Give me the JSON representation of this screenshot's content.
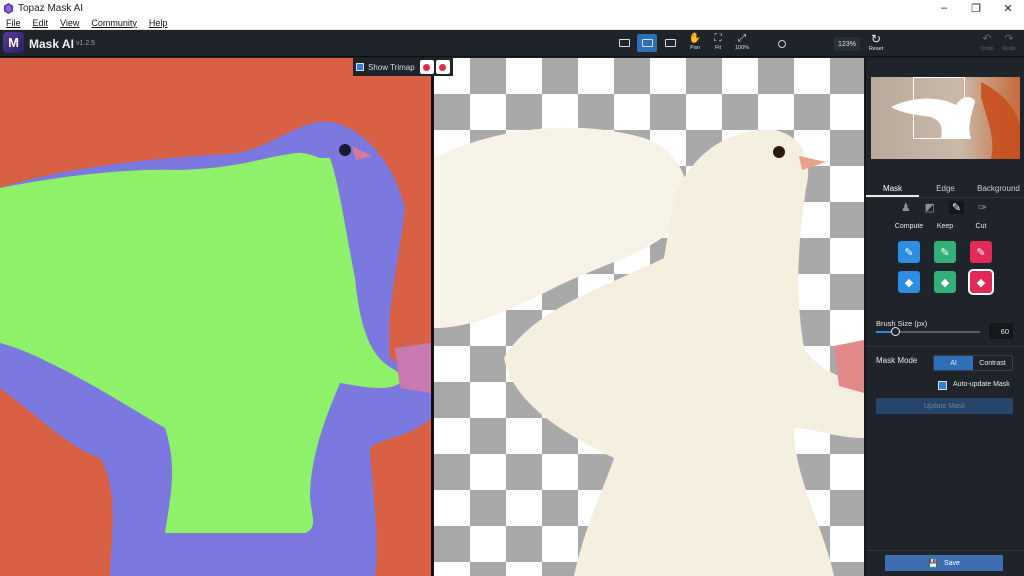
{
  "window": {
    "title": "Topaz Mask AI",
    "minimize": "–",
    "maximize": "❐",
    "close": "✕"
  },
  "menu": {
    "items": [
      "File",
      "Edit",
      "View",
      "Community",
      "Help"
    ]
  },
  "header": {
    "logo_letter": "M",
    "app_name": "Mask AI",
    "version": "v1.2.5"
  },
  "toolbar": {
    "tools": [
      {
        "icon": "hand-icon",
        "glyph": "✋",
        "label": "Pan"
      },
      {
        "icon": "fit-icon",
        "glyph": "⛶",
        "label": "Fit"
      },
      {
        "icon": "zoom-100-icon",
        "glyph": "⤢",
        "label": "100%"
      }
    ],
    "zoom_value": "123%",
    "reset_label": "Reset",
    "undo_label": "Undo",
    "redo_label": "Redo",
    "reset_glyph": "↻",
    "undo_glyph": "↶",
    "redo_glyph": "↷"
  },
  "canvas": {
    "show_trimap_label": "Show Trimap",
    "show_trimap_checked": true
  },
  "panel": {
    "tabs": [
      "Mask",
      "Edge",
      "Background"
    ],
    "active_tab": "Mask",
    "columns": [
      "Compute",
      "Keep",
      "Cut"
    ],
    "brush_size_label": "Brush Size (px)",
    "brush_size_value": "60",
    "brush_size_fraction": 0.16,
    "mask_mode_label": "Mask Mode",
    "mask_mode_options": [
      "AI",
      "Contrast"
    ],
    "mask_mode_selected": "AI",
    "auto_update_label": "Auto-update Mask",
    "auto_update_checked": true,
    "update_mask_label": "Update Mask",
    "save_label": "Save"
  },
  "colors": {
    "accent": "#2e6fb5",
    "compute": "#2d8ce3",
    "keep": "#32b07a",
    "cut": "#e02a5a",
    "background_orange": "#d86145",
    "mask_green": "#8ff06a",
    "mask_blue": "#7b79e0"
  }
}
